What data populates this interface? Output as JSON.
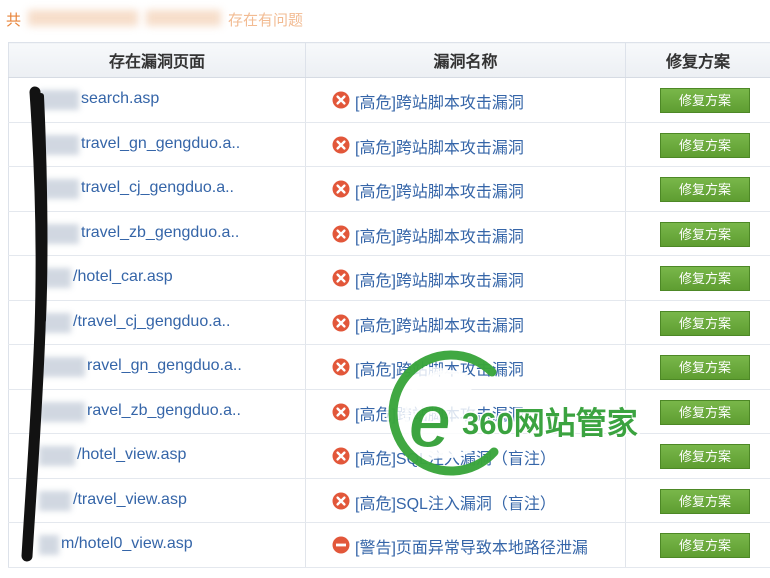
{
  "summary": {
    "prefix": "共",
    "suffix": "存在有问题"
  },
  "table": {
    "headers": {
      "page": "存在漏洞页面",
      "vuln": "漏洞名称",
      "fix": "修复方案"
    },
    "rows": [
      {
        "page": "search.asp",
        "level": "high",
        "vuln": "[高危]跨站脚本攻击漏洞",
        "action": "修复方案"
      },
      {
        "page": "travel_gn_gengduo.a..",
        "level": "high",
        "vuln": "[高危]跨站脚本攻击漏洞",
        "action": "修复方案"
      },
      {
        "page": "travel_cj_gengduo.a..",
        "level": "high",
        "vuln": "[高危]跨站脚本攻击漏洞",
        "action": "修复方案"
      },
      {
        "page": "travel_zb_gengduo.a..",
        "level": "high",
        "vuln": "[高危]跨站脚本攻击漏洞",
        "action": "修复方案"
      },
      {
        "page": "/hotel_car.asp",
        "level": "high",
        "vuln": "[高危]跨站脚本攻击漏洞",
        "action": "修复方案"
      },
      {
        "page": "/travel_cj_gengduo.a..",
        "level": "high",
        "vuln": "[高危]跨站脚本攻击漏洞",
        "action": "修复方案"
      },
      {
        "page": "ravel_gn_gengduo.a..",
        "level": "high",
        "vuln": "[高危]跨站脚本攻击漏洞",
        "action": "修复方案"
      },
      {
        "page": "ravel_zb_gengduo.a..",
        "level": "high",
        "vuln": "[高危]跨站脚本攻击漏洞",
        "action": "修复方案"
      },
      {
        "page": "/hotel_view.asp",
        "level": "high",
        "vuln": "[高危]SQL注入漏洞（盲注）",
        "action": "修复方案"
      },
      {
        "page": "/travel_view.asp",
        "level": "high",
        "vuln": "[高危]SQL注入漏洞（盲注）",
        "action": "修复方案"
      },
      {
        "page": "m/hotel0_view.asp",
        "level": "warning",
        "vuln": "[警告]页面异常导致本地路径泄漏",
        "action": "修复方案"
      }
    ]
  },
  "icons": {
    "high": "error-x-icon",
    "warning": "warning-minus-icon"
  },
  "watermark": {
    "text": "360网站管家",
    "color": "#35a13a"
  },
  "colors": {
    "link": "#3565a8",
    "summary": "#e8843a",
    "icon_red": "#e2573a",
    "button_green": "#5e9d31"
  }
}
